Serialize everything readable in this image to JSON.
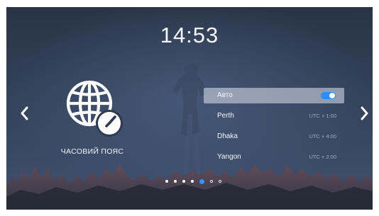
{
  "clock": {
    "time": "14:53"
  },
  "section": {
    "title": "ЧАСОВИЙ ПОЯС",
    "icon": "globe-clock-icon"
  },
  "navigation": {
    "prev_icon": "chevron-left-icon",
    "next_icon": "chevron-right-icon"
  },
  "timezones": [
    {
      "name": "Авто",
      "offset": "",
      "toggle": true,
      "selected": true
    },
    {
      "name": "Perth",
      "offset": "UTC + 1:00",
      "selected": false
    },
    {
      "name": "Dhaka",
      "offset": "UTC + 4:00",
      "selected": false
    },
    {
      "name": "Yangon",
      "offset": "UTC + 2:00",
      "selected": false
    }
  ],
  "pager": {
    "total": 7,
    "current": 5
  },
  "colors": {
    "accent": "#3a93f5",
    "toggle_on": "#2f8cf2",
    "background_top": "#283446",
    "background_bottom": "#3f5070"
  }
}
